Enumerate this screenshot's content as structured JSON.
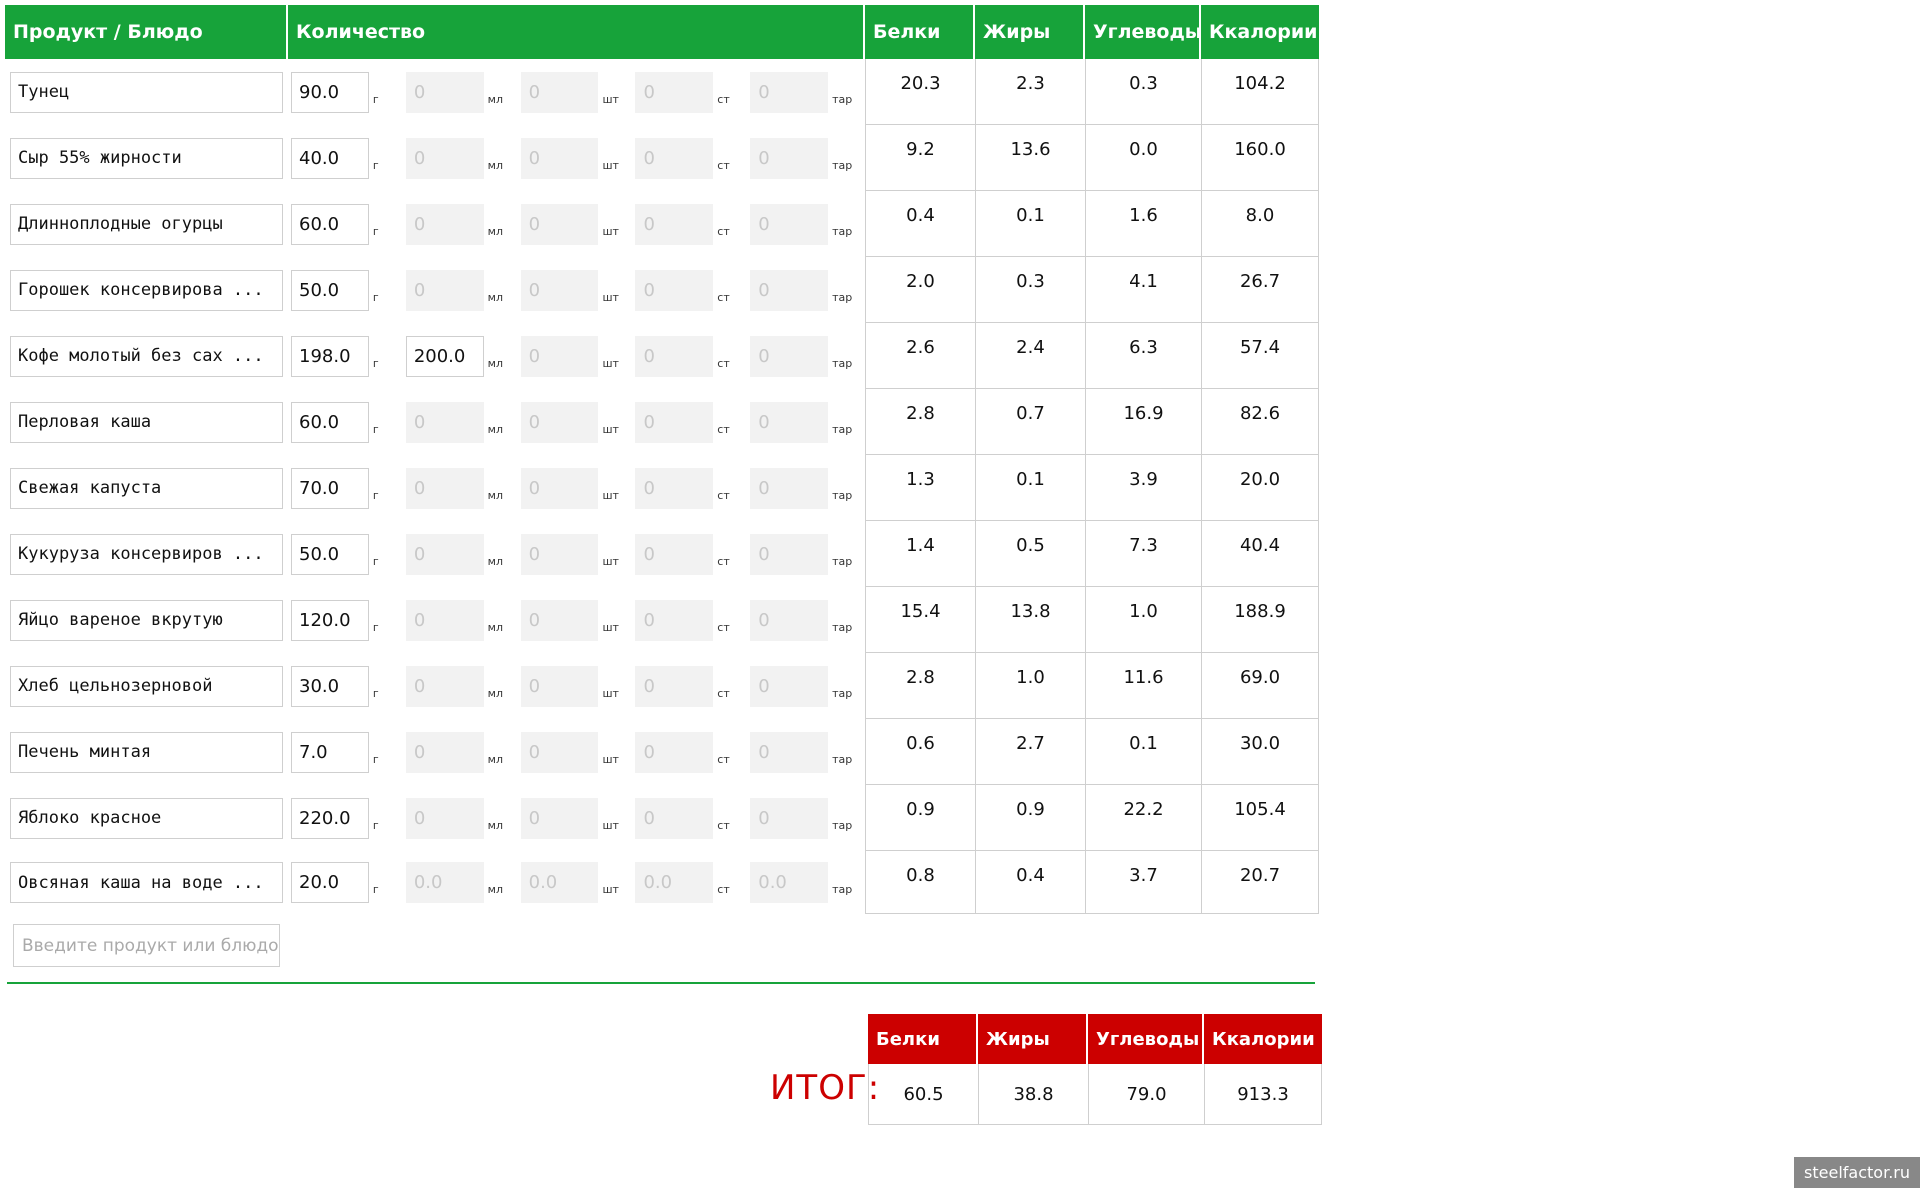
{
  "header": {
    "product": "Продукт / Блюдо",
    "quantity": "Количество",
    "protein": "Белки",
    "fat": "Жиры",
    "carbs": "Углеводы",
    "kcal": "Ккалории"
  },
  "units": {
    "g": "г",
    "ml": "мл",
    "pcs": "шт",
    "st": "ст",
    "tar": "тар"
  },
  "rows": [
    {
      "name": "Тунец",
      "g": "90.0",
      "ml": "0",
      "pcs": "0",
      "st": "0",
      "tar": "0",
      "protein": "20.3",
      "fat": "2.3",
      "carbs": "0.3",
      "kcal": "104.2"
    },
    {
      "name": "Сыр 55% жирности",
      "g": "40.0",
      "ml": "0",
      "pcs": "0",
      "st": "0",
      "tar": "0",
      "protein": "9.2",
      "fat": "13.6",
      "carbs": "0.0",
      "kcal": "160.0"
    },
    {
      "name": "Длинноплодные огурцы",
      "g": "60.0",
      "ml": "0",
      "pcs": "0",
      "st": "0",
      "tar": "0",
      "protein": "0.4",
      "fat": "0.1",
      "carbs": "1.6",
      "kcal": "8.0"
    },
    {
      "name": "Горошек консервирова ...",
      "g": "50.0",
      "ml": "0",
      "pcs": "0",
      "st": "0",
      "tar": "0",
      "protein": "2.0",
      "fat": "0.3",
      "carbs": "4.1",
      "kcal": "26.7"
    },
    {
      "name": "Кофе молотый без сах ...",
      "g": "198.0",
      "ml": "200.0",
      "pcs": "0",
      "st": "0",
      "tar": "0",
      "protein": "2.6",
      "fat": "2.4",
      "carbs": "6.3",
      "kcal": "57.4"
    },
    {
      "name": "Перловая каша",
      "g": "60.0",
      "ml": "0",
      "pcs": "0",
      "st": "0",
      "tar": "0",
      "protein": "2.8",
      "fat": "0.7",
      "carbs": "16.9",
      "kcal": "82.6"
    },
    {
      "name": "Свежая капуста",
      "g": "70.0",
      "ml": "0",
      "pcs": "0",
      "st": "0",
      "tar": "0",
      "protein": "1.3",
      "fat": "0.1",
      "carbs": "3.9",
      "kcal": "20.0"
    },
    {
      "name": "Кукуруза консервиров ...",
      "g": "50.0",
      "ml": "0",
      "pcs": "0",
      "st": "0",
      "tar": "0",
      "protein": "1.4",
      "fat": "0.5",
      "carbs": "7.3",
      "kcal": "40.4"
    },
    {
      "name": "Яйцо вареное вкрутую",
      "g": "120.0",
      "ml": "0",
      "pcs": "0",
      "st": "0",
      "tar": "0",
      "protein": "15.4",
      "fat": "13.8",
      "carbs": "1.0",
      "kcal": "188.9"
    },
    {
      "name": "Хлеб цельнозерновой",
      "g": "30.0",
      "ml": "0",
      "pcs": "0",
      "st": "0",
      "tar": "0",
      "protein": "2.8",
      "fat": "1.0",
      "carbs": "11.6",
      "kcal": "69.0"
    },
    {
      "name": "Печень минтая",
      "g": "7.0",
      "ml": "0",
      "pcs": "0",
      "st": "0",
      "tar": "0",
      "protein": "0.6",
      "fat": "2.7",
      "carbs": "0.1",
      "kcal": "30.0"
    },
    {
      "name": "Яблоко красное",
      "g": "220.0",
      "ml": "0",
      "pcs": "0",
      "st": "0",
      "tar": "0",
      "protein": "0.9",
      "fat": "0.9",
      "carbs": "22.2",
      "kcal": "105.4"
    },
    {
      "name": "Овсяная каша на воде ...",
      "g": "20.0",
      "ml": "0.0",
      "pcs": "0.0",
      "st": "0.0",
      "tar": "0.0",
      "protein": "0.8",
      "fat": "0.4",
      "carbs": "3.7",
      "kcal": "20.7"
    }
  ],
  "add_placeholder": "Введите продукт или блюдо",
  "totals": {
    "label": "ИТОГ:",
    "protein": "60.5",
    "fat": "38.8",
    "carbs": "79.0",
    "kcal": "913.3"
  },
  "watermark": "steelfactor.ru",
  "colors": {
    "header_green": "#17a33a",
    "totals_red": "#cc0000"
  }
}
